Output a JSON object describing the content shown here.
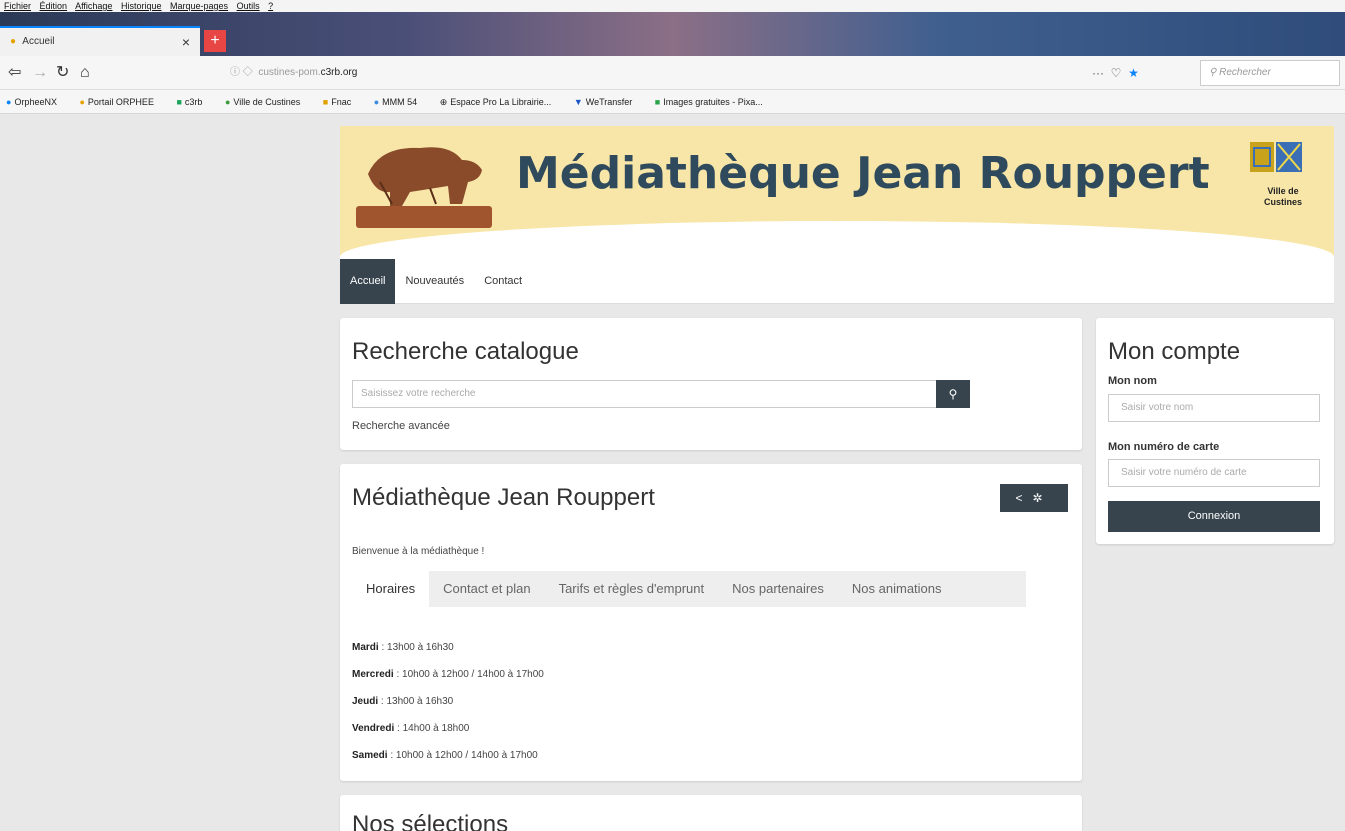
{
  "browser": {
    "menu": [
      "Fichier",
      "Édition",
      "Affichage",
      "Historique",
      "Marque-pages",
      "Outils",
      "?"
    ],
    "tab_title": "Accueil",
    "url_prefix": "custines-pom.",
    "url_domain": "c3rb.org",
    "search_placeholder": "Rechercher",
    "bookmarks": [
      "OrpheeNX",
      "Portail ORPHEE",
      "c3rb",
      "Ville de Custines",
      "Fnac",
      "MMM 54",
      "Espace Pro La Librairie...",
      "WeTransfer",
      "Images gratuites - Pixa..."
    ]
  },
  "banner": {
    "title": "Médiathèque Jean Rouppert",
    "crest_label_1": "Ville de",
    "crest_label_2": "Custines"
  },
  "nav": {
    "items": [
      "Accueil",
      "Nouveautés",
      "Contact"
    ]
  },
  "catalog": {
    "title": "Recherche catalogue",
    "placeholder": "Saisissez votre recherche",
    "advanced": "Recherche avancée"
  },
  "media": {
    "title": "Médiathèque Jean Rouppert",
    "welcome": "Bienvenue à la médiathèque !",
    "tabs": [
      "Horaires",
      "Contact et plan",
      "Tarifs et règles d'emprunt",
      "Nos partenaires",
      "Nos animations"
    ],
    "hours": [
      {
        "day": "Mardi",
        "time": " : 13h00 à 16h30"
      },
      {
        "day": "Mercredi",
        "time": " : 10h00 à 12h00 / 14h00 à 17h00"
      },
      {
        "day": "Jeudi",
        "time": " : 13h00 à 16h30"
      },
      {
        "day": "Vendredi",
        "time": " : 14h00 à 18h00"
      },
      {
        "day": "Samedi",
        "time": " : 10h00 à 12h00 / 14h00 à 17h00"
      }
    ]
  },
  "selections": {
    "title": "Nos sélections"
  },
  "account": {
    "title": "Mon compte",
    "name_label": "Mon nom",
    "name_placeholder": "Saisir votre nom",
    "card_label": "Mon numéro de carte",
    "card_placeholder": "Saisir votre numéro de carte",
    "login": "Connexion"
  },
  "colors": {
    "accent": "#37444d",
    "banner_bg": "#f8e6a8",
    "banner_title": "#2f4a5c"
  }
}
